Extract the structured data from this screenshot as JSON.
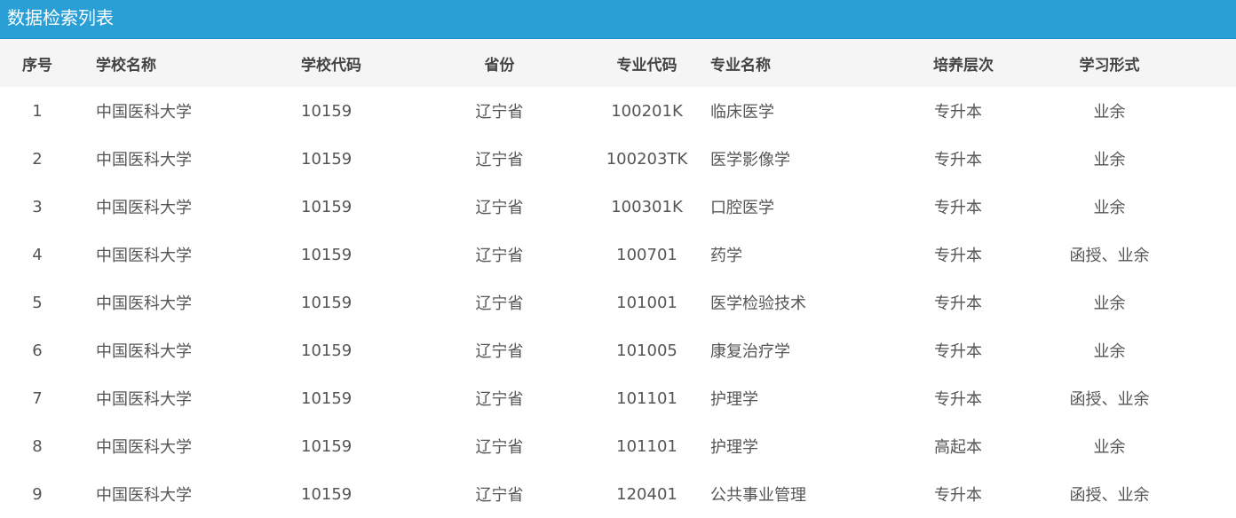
{
  "title": "数据检索列表",
  "table": {
    "headers": [
      "序号",
      "学校名称",
      "学校代码",
      "省份",
      "专业代码",
      "专业名称",
      "培养层次",
      "学习形式"
    ],
    "rows": [
      [
        "1",
        "中国医科大学",
        "10159",
        "辽宁省",
        "100201K",
        "临床医学",
        "专升本",
        "业余"
      ],
      [
        "2",
        "中国医科大学",
        "10159",
        "辽宁省",
        "100203TK",
        "医学影像学",
        "专升本",
        "业余"
      ],
      [
        "3",
        "中国医科大学",
        "10159",
        "辽宁省",
        "100301K",
        "口腔医学",
        "专升本",
        "业余"
      ],
      [
        "4",
        "中国医科大学",
        "10159",
        "辽宁省",
        "100701",
        "药学",
        "专升本",
        "函授、业余"
      ],
      [
        "5",
        "中国医科大学",
        "10159",
        "辽宁省",
        "101001",
        "医学检验技术",
        "专升本",
        "业余"
      ],
      [
        "6",
        "中国医科大学",
        "10159",
        "辽宁省",
        "101005",
        "康复治疗学",
        "专升本",
        "业余"
      ],
      [
        "7",
        "中国医科大学",
        "10159",
        "辽宁省",
        "101101",
        "护理学",
        "专升本",
        "函授、业余"
      ],
      [
        "8",
        "中国医科大学",
        "10159",
        "辽宁省",
        "101101",
        "护理学",
        "高起本",
        "业余"
      ],
      [
        "9",
        "中国医科大学",
        "10159",
        "辽宁省",
        "120401",
        "公共事业管理",
        "专升本",
        "函授、业余"
      ]
    ]
  },
  "colors": {
    "title_bar": "#2a9fd6",
    "header_bg": "#f5f5f5",
    "text": "#555555"
  }
}
